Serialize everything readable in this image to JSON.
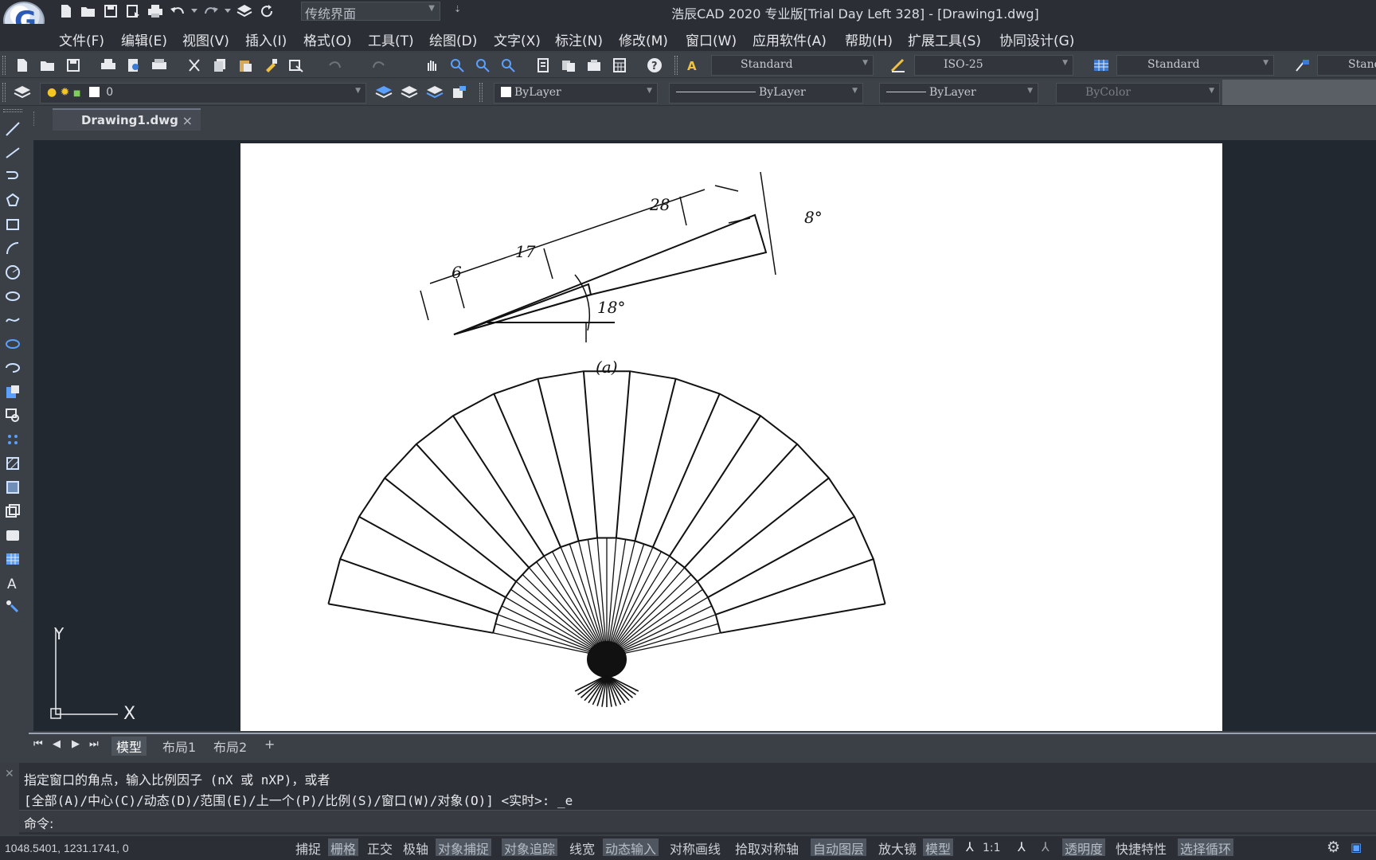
{
  "app": {
    "title": "浩辰CAD 2020 专业版[Trial Day Left 328] - [Drawing1.dwg]",
    "workspace": "传统界面",
    "logo_letter": "G"
  },
  "menu": [
    "文件(F)",
    "编辑(E)",
    "视图(V)",
    "插入(I)",
    "格式(O)",
    "工具(T)",
    "绘图(D)",
    "文字(X)",
    "标注(N)",
    "修改(M)",
    "窗口(W)",
    "应用软件(A)",
    "帮助(H)",
    "扩展工具(S)",
    "协同设计(G)"
  ],
  "toolbar": {
    "text_style": "Standard",
    "dim_style": "ISO-25",
    "table_style": "Standard",
    "mleader_style": "Stand"
  },
  "properties": {
    "layer": "0",
    "color": "ByLayer",
    "linetype": "ByLayer",
    "lineweight": "ByLayer",
    "plotstyle": "ByColor"
  },
  "doc_tab": {
    "name": "Drawing1.dwg",
    "close": "×"
  },
  "layout_tabs": [
    "模型",
    "布局1",
    "布局2",
    "+"
  ],
  "drawing": {
    "dims": [
      "28",
      "17",
      "6",
      "8°",
      "18°"
    ],
    "caption": "(a)"
  },
  "ucs": {
    "x": "X",
    "y": "Y"
  },
  "command": {
    "line1": "指定窗口的角点，输入比例因子 (nX 或 nXP)，或者",
    "line2": "[全部(A)/中心(C)/动态(D)/范围(E)/上一个(P)/比例(S)/窗口(W)/对象(O)] <实时>: _e",
    "prompt": "命令:"
  },
  "status": {
    "coords": "1048.5401, 1231.1741, 0",
    "scale": "1:1",
    "toggles": [
      {
        "label": "捕捉",
        "on": false
      },
      {
        "label": "栅格",
        "on": true
      },
      {
        "label": "正交",
        "on": false
      },
      {
        "label": "极轴",
        "on": false
      },
      {
        "label": "对象捕捉",
        "on": true
      },
      {
        "label": "对象追踪",
        "on": true
      },
      {
        "label": "线宽",
        "on": false
      },
      {
        "label": "动态输入",
        "on": true
      },
      {
        "label": "对称画线",
        "on": false
      },
      {
        "label": "拾取对称轴",
        "on": false
      },
      {
        "label": "自动图层",
        "on": true
      },
      {
        "label": "放大镜",
        "on": false
      },
      {
        "label": "模型",
        "on": true
      }
    ],
    "right": [
      {
        "label": "透明度",
        "on": true
      },
      {
        "label": "快捷特性",
        "on": false
      },
      {
        "label": "选择循环",
        "on": true
      }
    ]
  }
}
